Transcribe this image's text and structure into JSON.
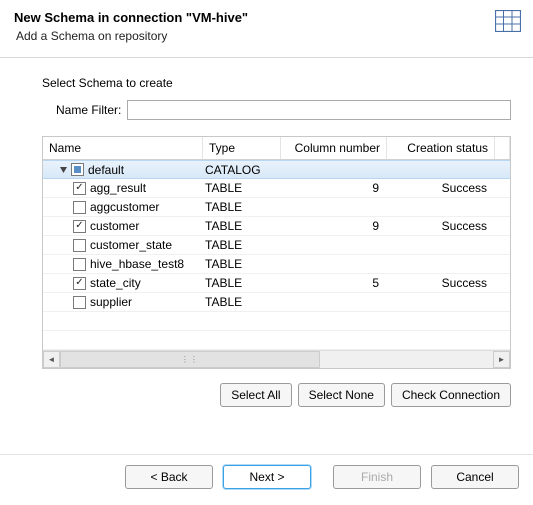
{
  "header": {
    "title": "New Schema in connection \"VM-hive\"",
    "subtitle": "Add a Schema on repository"
  },
  "section": {
    "label": "Select Schema to create",
    "name_filter_label": "Name Filter:",
    "name_filter_value": ""
  },
  "table": {
    "columns": {
      "name": "Name",
      "type": "Type",
      "column_number": "Column number",
      "creation_status": "Creation status"
    },
    "root": {
      "name": "default",
      "type": "CATALOG",
      "checked": "partial",
      "expanded": true
    },
    "rows": [
      {
        "name": "agg_result",
        "type": "TABLE",
        "column_number": "9",
        "creation_status": "Success",
        "checked": true
      },
      {
        "name": "aggcustomer",
        "type": "TABLE",
        "column_number": "",
        "creation_status": "",
        "checked": false
      },
      {
        "name": "customer",
        "type": "TABLE",
        "column_number": "9",
        "creation_status": "Success",
        "checked": true
      },
      {
        "name": "customer_state",
        "type": "TABLE",
        "column_number": "",
        "creation_status": "",
        "checked": false
      },
      {
        "name": "hive_hbase_test8",
        "type": "TABLE",
        "column_number": "",
        "creation_status": "",
        "checked": false
      },
      {
        "name": "state_city",
        "type": "TABLE",
        "column_number": "5",
        "creation_status": "Success",
        "checked": true
      },
      {
        "name": "supplier",
        "type": "TABLE",
        "column_number": "",
        "creation_status": "",
        "checked": false
      }
    ]
  },
  "buttons": {
    "select_all": "Select All",
    "select_none": "Select None",
    "check_connection": "Check Connection",
    "back": "< Back",
    "next": "Next >",
    "finish": "Finish",
    "cancel": "Cancel"
  }
}
